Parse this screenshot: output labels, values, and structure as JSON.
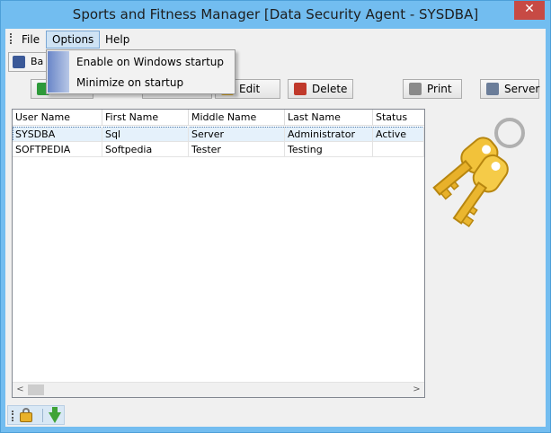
{
  "window": {
    "title": "Sports and Fitness Manager [Data Security Agent - SYSDBA]",
    "close_glyph": "✕"
  },
  "menubar": {
    "items": [
      {
        "label": "File"
      },
      {
        "label": "Options"
      },
      {
        "label": "Help"
      }
    ]
  },
  "options_menu": {
    "items": [
      {
        "label": "Enable on Windows startup"
      },
      {
        "label": "Minimize on startup"
      }
    ]
  },
  "toolbar1": {
    "back_label": "Ba"
  },
  "toolbar2": {
    "edit_label": "Edit",
    "delete_label": "Delete",
    "print_label": "Print",
    "server_label": "Server"
  },
  "grid": {
    "columns": [
      "User Name",
      "First Name",
      "Middle Name",
      "Last Name",
      "Status"
    ],
    "rows": [
      {
        "user": "SYSDBA",
        "first": "Sql",
        "middle": "Server",
        "last": "Administrator",
        "status": "Active"
      },
      {
        "user": "SOFTPEDIA",
        "first": "Softpedia",
        "middle": "Tester",
        "last": "Testing",
        "status": ""
      }
    ]
  },
  "scrollbar": {
    "left_glyph": "<",
    "right_glyph": ">"
  },
  "icons": {
    "keys": "keys-icon",
    "lock": "lock-icon",
    "download": "download-icon",
    "refresh": "refresh-icon",
    "edit": "edit-icon",
    "delete": "delete-user-icon",
    "print": "printer-icon",
    "server": "server-icon",
    "save": "save-icon"
  },
  "colors": {
    "titlebar": "#73bdf0",
    "close_button": "#c74a44",
    "selected_row": "#e5f1fb",
    "key_gold": "#e8b12a"
  }
}
